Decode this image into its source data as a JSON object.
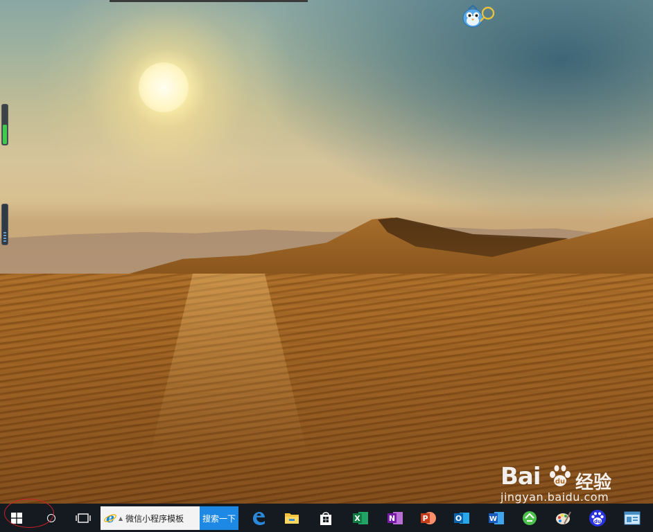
{
  "taskbar": {
    "start": {
      "icon": "windows-logo-icon"
    },
    "cortana": {
      "icon": "cortana-circle-icon"
    },
    "task_view": {
      "icon": "task-view-icon"
    },
    "search": {
      "engine_icon": "internet-explorer-icon",
      "value": "微信小程序模板",
      "button_label": "搜索一下"
    },
    "pinned_apps": [
      {
        "name": "Microsoft Edge",
        "icon": "edge-icon"
      },
      {
        "name": "File Explorer",
        "icon": "file-explorer-icon"
      },
      {
        "name": "Microsoft Store",
        "icon": "store-icon"
      },
      {
        "name": "Excel",
        "icon": "excel-icon",
        "letter": "X"
      },
      {
        "name": "OneNote",
        "icon": "onenote-icon",
        "letter": "N"
      },
      {
        "name": "PowerPoint",
        "icon": "powerpoint-icon",
        "letter": "P"
      },
      {
        "name": "Outlook",
        "icon": "outlook-icon",
        "letter": "O"
      },
      {
        "name": "Word",
        "icon": "word-icon",
        "letter": "W"
      },
      {
        "name": "Green app",
        "icon": "green-circle-app-icon"
      },
      {
        "name": "Paint",
        "icon": "paint-palette-icon"
      },
      {
        "name": "Baidu",
        "icon": "baidu-paw-icon",
        "letter": "du"
      },
      {
        "name": "Control panel",
        "icon": "window-card-icon"
      }
    ]
  },
  "desktop": {
    "wallpaper": "desert-sunset",
    "pet_icon": "desktop-pet-bird-icon"
  },
  "watermark": {
    "logo_text": "Bai",
    "logo_suffix": "经验",
    "url": "jingyan.baidu.com"
  },
  "colors": {
    "taskbar_bg": "#141a20",
    "search_button_bg": "#1e88e5",
    "annotation_circle": "#c9202a"
  }
}
